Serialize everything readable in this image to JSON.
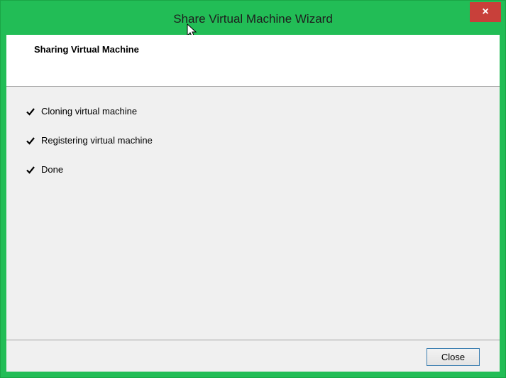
{
  "window": {
    "title": "Share Virtual Machine Wizard",
    "close_glyph": "×",
    "accent_color": "#22bd56",
    "close_button_color": "#c8403a"
  },
  "header": {
    "title": "Sharing Virtual Machine"
  },
  "steps": [
    {
      "icon": "check-icon",
      "label": "Cloning virtual machine"
    },
    {
      "icon": "check-icon",
      "label": "Registering virtual machine"
    },
    {
      "icon": "check-icon",
      "label": "Done"
    }
  ],
  "footer": {
    "close_label": "Close"
  }
}
